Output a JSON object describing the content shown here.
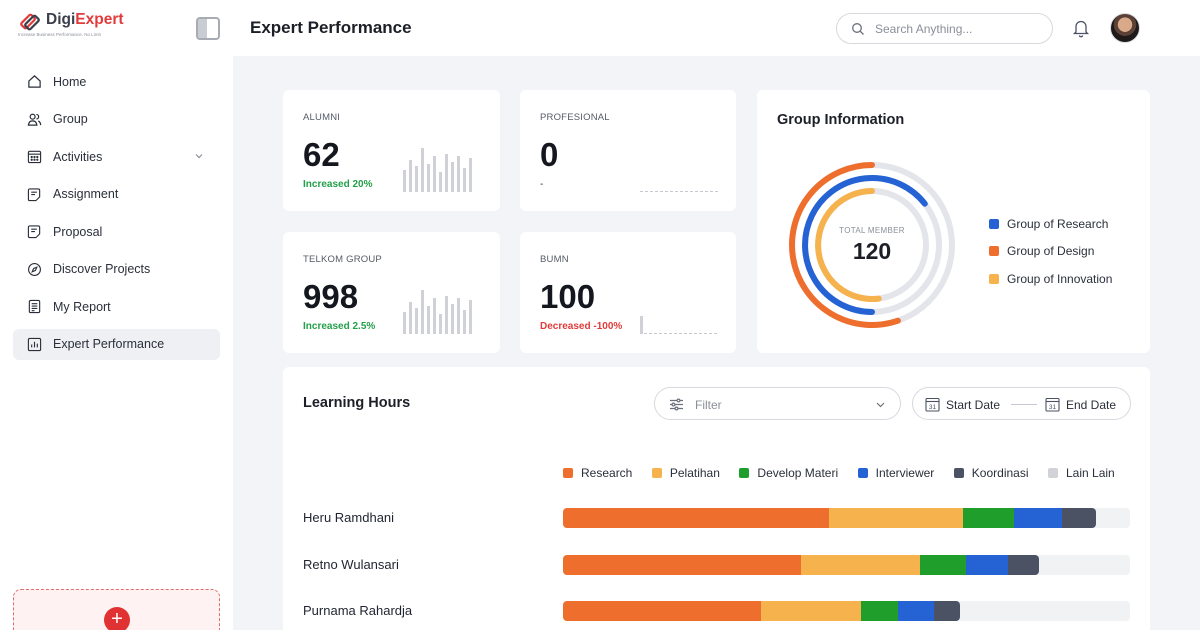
{
  "app": {
    "logo_part1": "Digi",
    "logo_part2": "Expert",
    "tagline": "Increase Business Performance, No Limit"
  },
  "header": {
    "title": "Expert Performance",
    "search_placeholder": "Search Anything..."
  },
  "sidebar": {
    "items": [
      {
        "label": "Home",
        "icon": "home-icon",
        "active": false
      },
      {
        "label": "Group",
        "icon": "users-icon",
        "active": false
      },
      {
        "label": "Activities",
        "icon": "calendar-icon",
        "active": false,
        "expandable": true
      },
      {
        "label": "Assignment",
        "icon": "assignment-icon",
        "active": false
      },
      {
        "label": "Proposal",
        "icon": "proposal-icon",
        "active": false
      },
      {
        "label": "Discover Projects",
        "icon": "compass-icon",
        "active": false
      },
      {
        "label": "My Report",
        "icon": "report-icon",
        "active": false
      },
      {
        "label": "Expert Performance",
        "icon": "performance-icon",
        "active": true
      }
    ]
  },
  "stats": [
    {
      "label": "ALUMNI",
      "value": "62",
      "change": "Increased 20%",
      "trend": "up"
    },
    {
      "label": "PROFESIONAL",
      "value": "0",
      "change": "-",
      "trend": "none"
    },
    {
      "label": "TELKOM GROUP",
      "value": "998",
      "change": "Increased 2.5%",
      "trend": "up"
    },
    {
      "label": "BUMN",
      "value": "100",
      "change": "Decreased -100%",
      "trend": "down"
    }
  ],
  "group_info": {
    "title": "Group Information",
    "center_label": "TOTAL MEMBER",
    "center_value": "120",
    "legend": [
      {
        "label": "Group of Research",
        "color": "#2563d4"
      },
      {
        "label": "Group of Design",
        "color": "#ee6f2d"
      },
      {
        "label": "Group of Innovation",
        "color": "#f5b24d"
      }
    ]
  },
  "learning_hours": {
    "title": "Learning Hours",
    "filter_placeholder": "Filter",
    "start_date": "Start Date",
    "end_date": "End Date",
    "calendar_day": "31",
    "legend": [
      {
        "label": "Research",
        "color": "#ee6f2d"
      },
      {
        "label": "Pelatihan",
        "color": "#f5b24d"
      },
      {
        "label": "Develop Materi",
        "color": "#1f9e2b"
      },
      {
        "label": "Interviewer",
        "color": "#2563d4"
      },
      {
        "label": "Koordinasi",
        "color": "#4b5263"
      },
      {
        "label": "Lain Lain",
        "color": "#d1d3d8"
      }
    ],
    "rows": [
      {
        "name": "Heru Ramdhani",
        "segments": [
          0.47,
          0.235,
          0.09,
          0.085,
          0.06
        ]
      },
      {
        "name": "Retno Wulansari",
        "segments": [
          0.42,
          0.21,
          0.08,
          0.075,
          0.055
        ]
      },
      {
        "name": "Purnama Rahardja",
        "segments": [
          0.35,
          0.175,
          0.065,
          0.065,
          0.045
        ]
      }
    ]
  }
}
